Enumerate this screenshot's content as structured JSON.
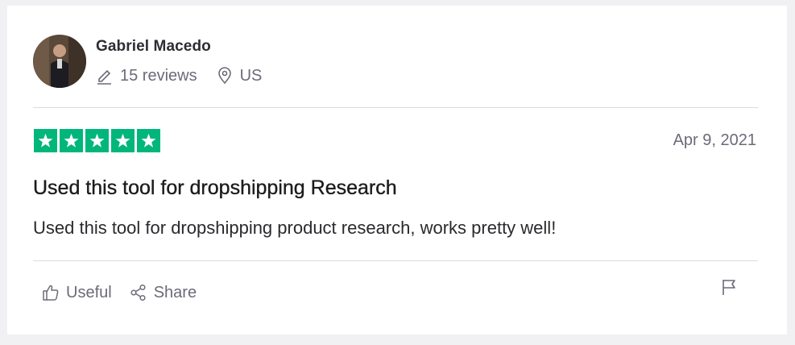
{
  "reviewer": {
    "name": "Gabriel Macedo",
    "reviews_count": "15 reviews",
    "country": "US"
  },
  "review": {
    "rating": 5,
    "max_rating": 5,
    "date": "Apr 9, 2021",
    "title": "Used this tool for dropshipping Research",
    "body": "Used this tool for dropshipping product research, works pretty well!"
  },
  "actions": {
    "useful_label": "Useful",
    "share_label": "Share"
  },
  "colors": {
    "star_green": "#00b67a",
    "muted_text": "#6b6b7a",
    "background": "#f1f1f3"
  },
  "icons": [
    "pencil-icon",
    "location-pin-icon",
    "star-icon",
    "thumbs-up-icon",
    "share-icon",
    "flag-icon"
  ]
}
